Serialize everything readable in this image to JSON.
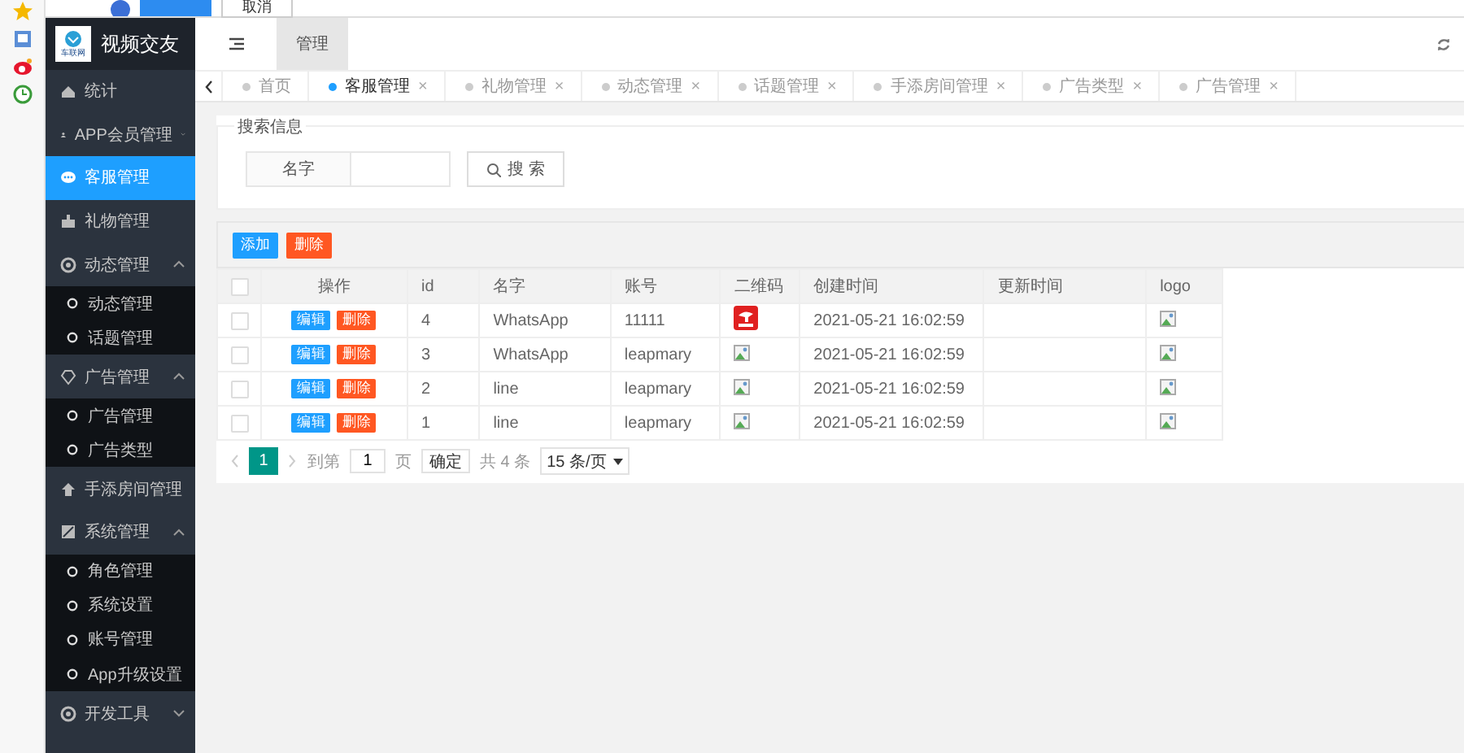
{
  "notification": {
    "buttons": [
      "取消"
    ]
  },
  "app": {
    "title": "视频交友",
    "logo_text": "车联网"
  },
  "sidebar": {
    "items": [
      {
        "label": "统计",
        "selected": false
      },
      {
        "label": "APP会员管理",
        "selected": false,
        "expanded": false
      },
      {
        "label": "客服管理",
        "selected": true
      },
      {
        "label": "礼物管理",
        "selected": false
      },
      {
        "label": "动态管理",
        "selected": false,
        "expanded": true,
        "children": [
          {
            "label": "动态管理",
            "selected": false
          },
          {
            "label": "话题管理",
            "selected": false
          }
        ]
      },
      {
        "label": "广告管理",
        "selected": false,
        "expanded": true,
        "children": [
          {
            "label": "广告管理",
            "selected": false
          },
          {
            "label": "广告类型",
            "selected": false
          }
        ]
      },
      {
        "label": "手添房间管理",
        "selected": false
      },
      {
        "label": "系统管理",
        "selected": false,
        "expanded": true,
        "children": [
          {
            "label": "角色管理",
            "selected": false
          },
          {
            "label": "系统设置",
            "selected": false
          },
          {
            "label": "账号管理",
            "selected": false
          },
          {
            "label": "App升级设置",
            "selected": false
          }
        ]
      },
      {
        "label": "开发工具",
        "selected": false,
        "expanded": false
      }
    ]
  },
  "header": {
    "tabs": [
      {
        "label": "管理",
        "selected": true
      }
    ]
  },
  "page_tabs": [
    {
      "label": "首页",
      "selected": false
    },
    {
      "label": "客服管理",
      "selected": true,
      "close": "×"
    },
    {
      "label": "礼物管理",
      "selected": false,
      "close": "×"
    },
    {
      "label": "动态管理",
      "selected": false,
      "close": "×"
    },
    {
      "label": "话题管理",
      "selected": false,
      "close": "×"
    },
    {
      "label": "手添房间管理",
      "selected": false,
      "close": "×"
    },
    {
      "label": "广告类型",
      "selected": false,
      "close": "×"
    },
    {
      "label": "广告管理",
      "selected": false,
      "close": "×"
    }
  ],
  "search": {
    "legend": "搜索信息",
    "field_label": "名字",
    "button": "搜 索"
  },
  "toolbar": {
    "buttons": [
      {
        "label": "添加",
        "kind": "primary"
      },
      {
        "label": "删除",
        "kind": "danger"
      }
    ]
  },
  "table": {
    "columns": [
      "操作",
      "id",
      "名字",
      "账号",
      "二维码",
      "创建时间",
      "更新时间",
      "logo"
    ],
    "header_checked": false,
    "rows": [
      {
        "checked": false,
        "actions": [
          "编辑",
          "删除"
        ],
        "id": "4",
        "name": "WhatsApp",
        "account": "11111",
        "qr_loaded": true,
        "created": "2021-05-21 16:02:59"
      },
      {
        "checked": false,
        "actions": [
          "编辑",
          "删除"
        ],
        "id": "3",
        "name": "WhatsApp",
        "account": "leapmary",
        "qr_loaded": false,
        "created": "2021-05-21 16:02:59"
      },
      {
        "checked": false,
        "actions": [
          "编辑",
          "删除"
        ],
        "id": "2",
        "name": "line",
        "account": "leapmary",
        "qr_loaded": false,
        "created": "2021-05-21 16:02:59"
      },
      {
        "checked": false,
        "actions": [
          "编辑",
          "删除"
        ],
        "id": "1",
        "name": "line",
        "account": "leapmary",
        "qr_loaded": false,
        "created": "2021-05-21 16:02:59"
      }
    ]
  },
  "pagination": {
    "pages": [
      {
        "label": "1",
        "selected": true
      }
    ],
    "goto_label": "到第",
    "page_value": "1",
    "page_unit": "页",
    "confirm": "确定",
    "total": "共 4 条",
    "page_size": "15 条/页"
  }
}
